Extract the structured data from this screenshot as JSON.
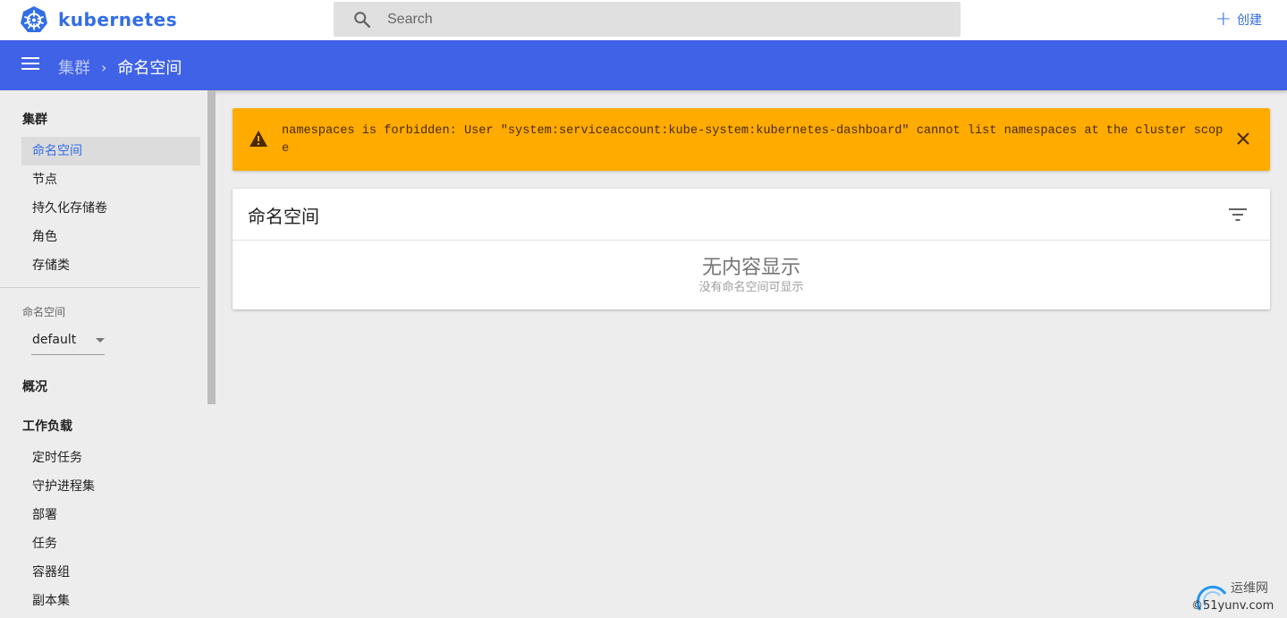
{
  "brand": {
    "name": "kubernetes",
    "color": "#326de6"
  },
  "search": {
    "placeholder": "Search"
  },
  "create": {
    "label": "创建"
  },
  "appbar": {
    "color": "#3f62e6",
    "breadcrumb": {
      "parent": "集群",
      "current": "命名空间"
    }
  },
  "sidebar": {
    "cluster_title": "集群",
    "cluster_items": [
      {
        "label": "命名空间",
        "active": true
      },
      {
        "label": "节点"
      },
      {
        "label": "持久化存储卷"
      },
      {
        "label": "角色"
      },
      {
        "label": "存储类"
      }
    ],
    "namespace_label": "命名空间",
    "namespace_value": "default",
    "overview": "概况",
    "workloads_title": "工作负载",
    "workload_items": [
      {
        "label": "定时任务"
      },
      {
        "label": "守护进程集"
      },
      {
        "label": "部署"
      },
      {
        "label": "任务"
      },
      {
        "label": "容器组"
      },
      {
        "label": "副本集"
      }
    ]
  },
  "alert": {
    "color": "#ffab00",
    "message": "namespaces is forbidden: User \"system:serviceaccount:kube-system:kubernetes-dashboard\" cannot list namespaces at the cluster scope"
  },
  "card": {
    "title": "命名空间",
    "empty_title": "无内容显示",
    "empty_subtitle": "没有命名空间可显示"
  },
  "watermark": {
    "text_line1": "运维网",
    "text_line2": "©51yunv.com"
  }
}
